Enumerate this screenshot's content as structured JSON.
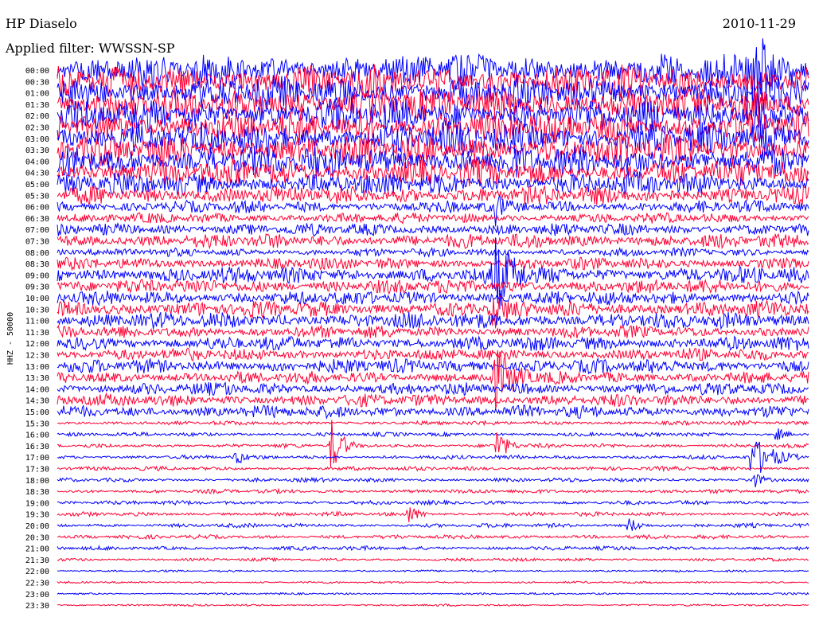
{
  "header": {
    "station": "HP Diaselo",
    "date": "2010-11-29",
    "filter": "Applied filter: WWSSN-SP"
  },
  "chart_data": {
    "type": "line",
    "title": "HP Diaselo",
    "date": "2010-11-29",
    "filter": "WWSSN-SP",
    "ylabel": "HHZ - 50000",
    "row_colors": [
      "#0000ff",
      "#ff0033"
    ],
    "row_labels": [
      "00:00",
      "00:30",
      "01:00",
      "01:30",
      "02:00",
      "02:30",
      "03:00",
      "03:30",
      "04:00",
      "04:30",
      "05:00",
      "05:30",
      "06:00",
      "06:30",
      "07:00",
      "07:30",
      "08:00",
      "08:30",
      "09:00",
      "09:30",
      "10:00",
      "10:30",
      "11:00",
      "11:30",
      "12:00",
      "12:30",
      "13:00",
      "13:30",
      "14:00",
      "14:30",
      "15:00",
      "15:30",
      "16:00",
      "16:30",
      "17:00",
      "17:30",
      "18:00",
      "18:30",
      "19:00",
      "19:30",
      "20:00",
      "20:30",
      "21:00",
      "21:30",
      "22:00",
      "22:30",
      "23:00",
      "23:30"
    ],
    "noise_amplitude": [
      16,
      16,
      16,
      16,
      16,
      16,
      16,
      15,
      15,
      13,
      11,
      9,
      6,
      5,
      6,
      7,
      4,
      6,
      8,
      7,
      7,
      8,
      8,
      6,
      7,
      6,
      7,
      6,
      6,
      6,
      6,
      2,
      2,
      2,
      2,
      2,
      2,
      2,
      2,
      2,
      2,
      2,
      2,
      1.5,
      1,
      1,
      1,
      1
    ],
    "events": [
      {
        "row": 0,
        "minute": 27.5,
        "amp": 85,
        "dur": 2
      },
      {
        "row": 2,
        "minute": 27.8,
        "amp": 35,
        "dur": 3
      },
      {
        "row": 4,
        "minute": 27.8,
        "amp": 25,
        "dur": 3
      },
      {
        "row": 12,
        "minute": 17.5,
        "amp": 25,
        "dur": 1
      },
      {
        "row": 18,
        "minute": 17.4,
        "amp": 60,
        "dur": 2
      },
      {
        "row": 21,
        "minute": 17.4,
        "amp": 30,
        "dur": 2
      },
      {
        "row": 27,
        "minute": 17.4,
        "amp": 45,
        "dur": 2
      },
      {
        "row": 33,
        "minute": 17.5,
        "amp": 25,
        "dur": 1
      },
      {
        "row": 28,
        "minute": 6.7,
        "amp": 14,
        "dur": 1
      },
      {
        "row": 33,
        "minute": 10.9,
        "amp": 40,
        "dur": 1
      },
      {
        "row": 32,
        "minute": 28.7,
        "amp": 10,
        "dur": 1
      },
      {
        "row": 34,
        "minute": 7.1,
        "amp": 12,
        "dur": 1
      },
      {
        "row": 34,
        "minute": 27.7,
        "amp": 30,
        "dur": 2
      },
      {
        "row": 36,
        "minute": 27.7,
        "amp": 14,
        "dur": 1
      },
      {
        "row": 39,
        "minute": 14.0,
        "amp": 14,
        "dur": 1
      },
      {
        "row": 40,
        "minute": 22.8,
        "amp": 12,
        "dur": 1
      }
    ]
  }
}
